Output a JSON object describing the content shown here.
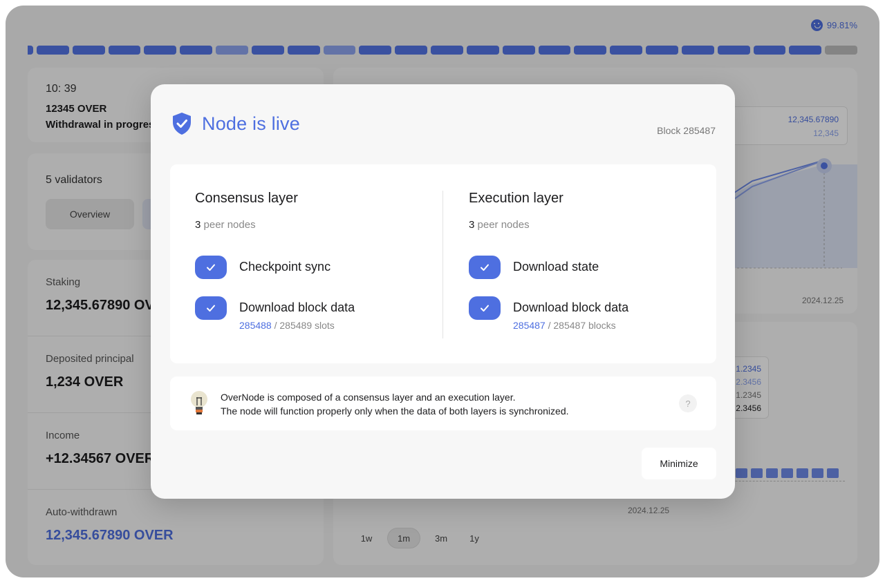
{
  "header": {
    "uptime_icon": "smile-icon",
    "uptime_value": "99.81%"
  },
  "segments": [
    "blue",
    "blue",
    "blue",
    "blue",
    "blue",
    "blue",
    "light",
    "blue",
    "blue",
    "light",
    "blue",
    "blue",
    "blue",
    "blue",
    "blue",
    "blue",
    "blue",
    "blue",
    "blue",
    "blue",
    "blue",
    "blue",
    "blue",
    "gray"
  ],
  "activity": {
    "time": "10: 39",
    "amount": "12345 OVER",
    "status": "Withdrawal in progress"
  },
  "validators": {
    "count_label": "5 validators",
    "tabs": [
      {
        "label": "Overview"
      },
      {
        "label": ""
      }
    ]
  },
  "stats": [
    {
      "label": "Staking",
      "value": "12,345.67890 OVER"
    },
    {
      "label": "Deposited principal",
      "value": "1,234 OVER"
    },
    {
      "label": "Income",
      "value": "+12.34567 OVER"
    },
    {
      "label": "Auto-withdrawn",
      "value": "12,345.67890 OVER"
    }
  ],
  "chart_top": {
    "tooltip_primary": "12,345.67890",
    "tooltip_secondary": "12,345",
    "date": "2024.12.25"
  },
  "chart_bottom": {
    "tooltip_values": [
      "1.2345",
      "2.3456",
      "1.2345",
      "2.3456"
    ],
    "date": "2024.12.25",
    "periods": [
      "1w",
      "1m",
      "3m",
      "1y"
    ],
    "active_period": "1m"
  },
  "modal": {
    "icon": "shield-check-icon",
    "title": "Node is live",
    "block": "Block 285487",
    "consensus": {
      "title": "Consensus layer",
      "peer_count": "3",
      "peer_label": "peer nodes",
      "steps": [
        {
          "label": "Checkpoint sync"
        },
        {
          "label": "Download block data",
          "current": "285488",
          "total": "/ 285489 slots"
        }
      ]
    },
    "execution": {
      "title": "Execution layer",
      "peer_count": "3",
      "peer_label": "peer nodes",
      "steps": [
        {
          "label": "Download state"
        },
        {
          "label": "Download block data",
          "current": "285487",
          "total": "/ 285487 blocks"
        }
      ]
    },
    "info": {
      "icon": "lightbulb-icon",
      "line1": "OverNode is composed of a consensus layer and an execution layer.",
      "line2": "The node will function properly only when the data of both layers is synchronized.",
      "help": "?"
    },
    "minimize_label": "Minimize"
  },
  "colors": {
    "accent": "#4e6fe0",
    "accent_light": "#8ea5ef"
  }
}
